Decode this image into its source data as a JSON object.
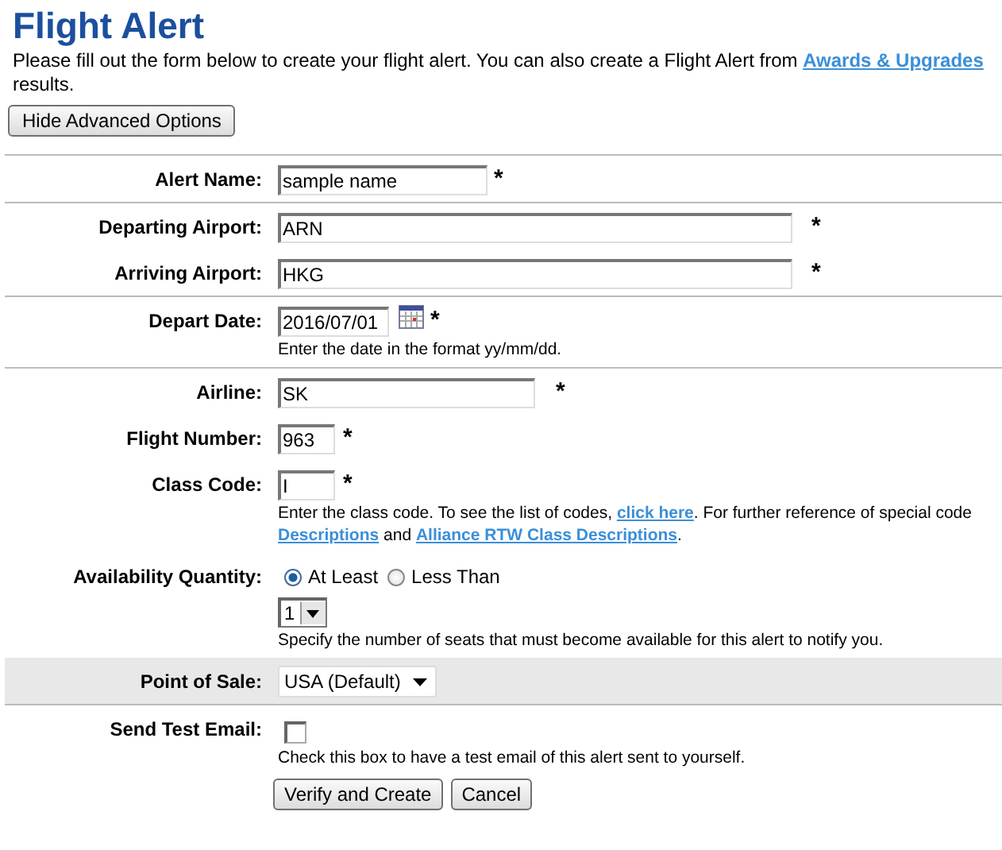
{
  "title": "Flight Alert",
  "intro": [
    {
      "kind": "text",
      "text": "Please fill out the form below to create your flight alert. You can also create a Flight Alert from"
    },
    {
      "kind": "link",
      "text": "Awards & Upgrades"
    },
    {
      "kind": "text",
      "text": "results."
    }
  ],
  "toggle_button": "Hide Advanced Options",
  "sections": [
    {
      "shaded": false,
      "rows": [
        {
          "kind": "name",
          "label": "Alert Name:",
          "value": "sample name",
          "required_mark": "*"
        }
      ]
    },
    {
      "shaded": false,
      "rows": [
        {
          "kind": "airport",
          "label": "Departing Airport:",
          "value": "ARN",
          "required_mark": "*"
        },
        {
          "kind": "airport",
          "label": "Arriving Airport:",
          "value": "HKG",
          "required_mark": "*"
        }
      ]
    },
    {
      "shaded": false,
      "rows": [
        {
          "kind": "date",
          "label": "Depart Date:",
          "value": "2016/07/01",
          "required_mark": "*",
          "hint": [
            {
              "kind": "text",
              "text": "Enter the date in the format yy/mm/dd."
            }
          ]
        }
      ]
    },
    {
      "shaded": false,
      "rows": [
        {
          "kind": "airline",
          "label": "Airline:",
          "value": "SK",
          "required_mark": "*"
        },
        {
          "kind": "short",
          "label": "Flight Number:",
          "value": "963",
          "required_mark": "*"
        },
        {
          "kind": "short",
          "label": "Class Code:",
          "value": "I",
          "required_mark": "*",
          "hint": [
            {
              "kind": "text",
              "text": "Enter the class code. To see the list of codes,"
            },
            {
              "kind": "link",
              "text": "click here"
            },
            {
              "kind": "text",
              "text": ". For further reference of special code"
            },
            {
              "kind": "break"
            },
            {
              "kind": "link",
              "text": "Descriptions"
            },
            {
              "kind": "text",
              "text": "and"
            },
            {
              "kind": "link",
              "text": "Alliance RTW Class Descriptions"
            },
            {
              "kind": "text",
              "text": "."
            }
          ]
        },
        {
          "kind": "radio",
          "label": "Availability Quantity:",
          "options": [
            {
              "label": "At Least",
              "selected": true
            },
            {
              "label": "Less Than",
              "selected": false
            }
          ],
          "quantity": "1",
          "hint": [
            {
              "kind": "text",
              "text": "Specify the number of seats that must become available for this alert to notify you."
            }
          ]
        }
      ]
    },
    {
      "shaded": true,
      "rows": [
        {
          "kind": "select",
          "label": "Point of Sale:",
          "value": "USA (Default)"
        }
      ]
    },
    {
      "shaded": false,
      "rows": [
        {
          "kind": "checkbox",
          "label": "Send Test Email:",
          "checked": false,
          "hint": [
            {
              "kind": "text",
              "text": "Check this box to have a test email of this alert sent to yourself."
            }
          ]
        }
      ]
    }
  ],
  "buttons": [
    "Verify and Create",
    "Cancel"
  ]
}
